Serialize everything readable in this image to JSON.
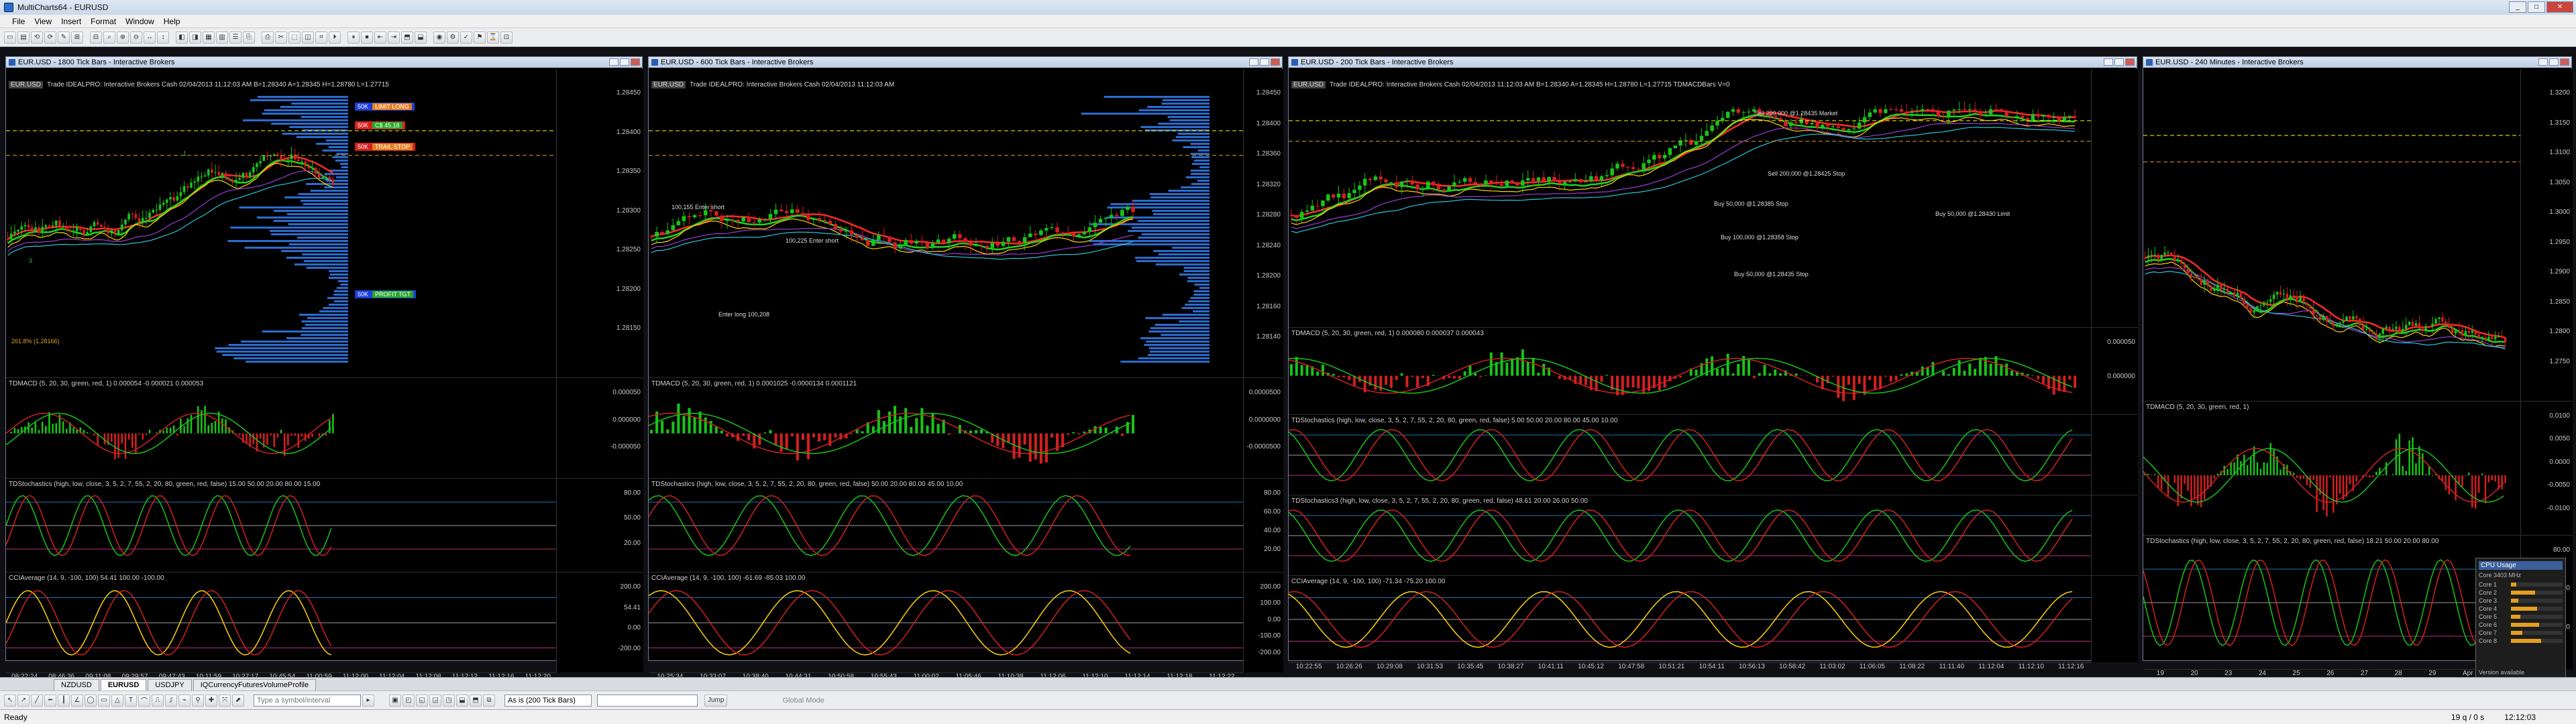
{
  "app": {
    "title": "MultiCharts64 - EURUSD"
  },
  "window_buttons": {
    "min": "_",
    "max": "□",
    "close": "✕"
  },
  "menu": [
    "File",
    "View",
    "Insert",
    "Format",
    "Window",
    "Help"
  ],
  "charts": [
    {
      "title": "EUR.USD - 1800 Tick Bars - Interactive Brokers",
      "stat": "Trade  IDEALPRO: Interactive Brokers  Cash  02/04/2013  11:12:03 AM  B=1.28340  A=1.28345  H=1.28780  L=1.27715",
      "price_ticks": [
        "1.28450",
        "1.28400",
        "1.28350",
        "1.28300",
        "1.28250",
        "1.28200",
        "1.28150"
      ],
      "orders": [
        {
          "side": "buy",
          "text": "50K",
          "extra": "LIMIT LONG"
        },
        {
          "side": "sell",
          "text": "50K",
          "extra": "C$ 45.18"
        },
        {
          "side": "sell",
          "text": "50K",
          "extra": "TRAIL STOP"
        },
        {
          "side": "buy",
          "text": "50K",
          "extra": "PROFIT TGT"
        }
      ],
      "fib_label": "261.8% (1.28166)",
      "wave_labels": [
        "1",
        "3"
      ],
      "macd_label": "TDMACD (5, 20, 30, green, red, 1)  0.000054  -0.000021  0.000053",
      "macd_ticks": [
        "0.000050",
        "0.000000",
        "-0.000050"
      ],
      "stoch_label": "TDStochastics (high, low, close, 3, 5, 2, 7, 55, 2, 20, 80, green, red, false)  15.00  50.00  20.00  80.00  15.00",
      "stoch_ticks": [
        "80.00",
        "50.00",
        "20.00"
      ],
      "cci_label": "CCIAverage (14, 9, -100, 100)  54.41  100.00  -100.00",
      "cci_ticks": [
        "200.00",
        "54.41",
        "0.00",
        "-200.00"
      ],
      "time_ticks": [
        "08:22:24",
        "08:46:36",
        "09:11:08",
        "09:29:57",
        "09:47:43",
        "10:11:59",
        "10:27:17",
        "10:45:54",
        "11:00:59",
        "11:12:00",
        "11:12:04",
        "11:12:08",
        "11:12:12",
        "11:12:16",
        "11:12:20"
      ]
    },
    {
      "title": "EUR.USD - 600 Tick Bars - Interactive Brokers",
      "stat": "Trade  IDEALPRO: Interactive Brokers  Cash  02/04/2013  11:12:03 AM",
      "price_ticks": [
        "1.28450",
        "1.28400",
        "1.28360",
        "1.28320",
        "1.28280",
        "1.28240",
        "1.28200",
        "1.28160",
        "1.28140"
      ],
      "annotations": [
        "100,155 Enter short",
        "100,225 Enter short",
        "Enter long 100,208"
      ],
      "macd_label": "TDMACD (5, 20, 30, green, red, 1)  0.0001025  -0.0000134  0.0001121",
      "macd_ticks": [
        "0.0000500",
        "0.0000000",
        "-0.0000500"
      ],
      "stoch_label": "TDStochastics (high, low, close, 3, 5, 2, 7, 55, 2, 20, 80, green, red, false)  50.00  20.00  80.00  45.00  10.00",
      "stoch_ticks": [
        "80.00",
        "60.00",
        "40.00",
        "20.00"
      ],
      "cci_label": "CCIAverage (14, 9, -100, 100)  -61.69  -85.03  100.00",
      "cci_ticks": [
        "200.00",
        "100.00",
        "0.00",
        "-100.00",
        "-200.00"
      ],
      "time_ticks": [
        "10:25:34",
        "10:33:07",
        "10:38:40",
        "10:44:31",
        "10:50:58",
        "10:55:43",
        "11:00:02",
        "11:05:46",
        "11:10:38",
        "11:12:06",
        "11:12:10",
        "11:12:14",
        "11:12:18",
        "11:12:22"
      ]
    },
    {
      "title": "EUR.USD - 200 Tick Bars - Interactive Brokers",
      "stat": "Trade  IDEALPRO: Interactive Brokers  Cash  02/04/2013  11:12:03 AM  B=1.28340  A=1.28345  H=1.28780  L=1.27715  TDMACDBars  V=0",
      "annotations": [
        "Sell 200,000 @1.28435 Market",
        "Sell 200,000 @1.28425 Stop",
        "Buy 50,000 @1.28385 Stop",
        "Buy 50,000 @1.28430 Limit",
        "Buy 100,000 @1.28358 Stop",
        "Buy 50,000 @1.28435 Stop"
      ],
      "macd_label": "TDMACD (5, 20, 30, green, red, 1)  0.000080  0.000037  0.000043",
      "macd_ticks": [
        "0.000050",
        "0.000000"
      ],
      "stoch_label": "TDStochastics (high, low, close, 3, 5, 2, 7, 55, 2, 20, 80, green, red, false)  5.00  50.00  20.00  80.00  45.00  10.00",
      "stoch2_label": "TDStochastics3 (high, low, close, 3, 5, 2, 7, 55, 2, 20, 80, green, red, false)  48.61  20.00  26.00  50.00",
      "cci_label": "CCIAverage (14, 9, -100, 100)  -71.34  -75.20  100.00",
      "time_ticks": [
        "10:22:55",
        "10:26:26",
        "10:29:08",
        "10:31:53",
        "10:35:45",
        "10:38:27",
        "10:41:11",
        "10:45:12",
        "10:47:58",
        "10:51:21",
        "10:54:11",
        "10:56:13",
        "10:58:42",
        "11:03:02",
        "11:06:05",
        "11:08:22",
        "11:11:40",
        "11:12:04",
        "11:12:10",
        "11:12:16"
      ]
    },
    {
      "title": "EUR.USD - 240 Minutes - Interactive Brokers",
      "price_ticks": [
        "1.3200",
        "1.3150",
        "1.3100",
        "1.3050",
        "1.3000",
        "1.2950",
        "1.2900",
        "1.2850",
        "1.2800",
        "1.2750"
      ],
      "macd_label": "TDMACD (5, 20, 30, green, red, 1)",
      "macd_ticks": [
        "0.0100",
        "0.0050",
        "0.0000",
        "-0.0050",
        "-0.0100"
      ],
      "stoch_label": "TDStochastics (high, low, close, 3, 5, 2, 7, 55, 2, 20, 80, green, red, false)  18.21  50.00  20.00  80.00",
      "stoch_ticks": [
        "80.00",
        "50.00",
        "20.00"
      ],
      "time_ticks": [
        "19",
        "20",
        "23",
        "24",
        "25",
        "26",
        "27",
        "28",
        "29",
        "Apr",
        "02"
      ]
    }
  ],
  "tabs": [
    "NZDUSD",
    "EURUSD",
    "USDJPY",
    "IQCurrencyFuturesVolumeProfile"
  ],
  "active_tab": "EURUSD",
  "drawbar": {
    "symbol_placeholder": "Type a symbol/interval",
    "resolution": "As is (200 Tick Bars)",
    "jump": "Jump",
    "mode": "Global Mode"
  },
  "status": {
    "left": "Ready",
    "right_a": "19 q / 0 s",
    "right_b": "12:12:03"
  },
  "cpu": {
    "title": "CPU Usage",
    "summary": "Core 3403 MHz",
    "rows": [
      "Core 1",
      "Core 2",
      "Core 3",
      "Core 4",
      "Core 5",
      "Core 6",
      "Core 7",
      "Core 8"
    ],
    "footer": "Version available"
  },
  "colors": {
    "bull": "#18c418",
    "bear": "#d42020",
    "ma1": "#ff2a2a",
    "ma2": "#21d321",
    "ma3": "#ffd400",
    "bg": "#000000",
    "profile": "#2f78e4"
  }
}
